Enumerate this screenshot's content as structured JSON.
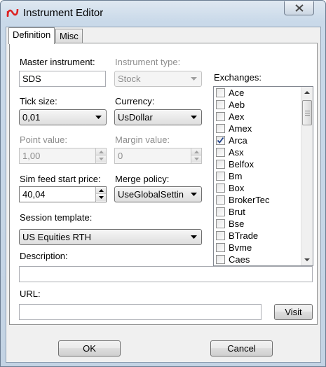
{
  "window": {
    "title": "Instrument Editor",
    "app_icon": "ninjatrader-logo-icon"
  },
  "tabs": [
    {
      "label": "Definition",
      "active": true
    },
    {
      "label": "Misc",
      "active": false
    }
  ],
  "form": {
    "master_instrument": {
      "label": "Master instrument:",
      "value": "SDS"
    },
    "instrument_type": {
      "label": "Instrument type:",
      "value": "Stock"
    },
    "tick_size": {
      "label": "Tick size:",
      "value": "0,01"
    },
    "currency": {
      "label": "Currency:",
      "value": "UsDollar"
    },
    "point_value": {
      "label": "Point value:",
      "value": "1,00"
    },
    "margin_value": {
      "label": "Margin value:",
      "value": "0"
    },
    "sim_feed_start_price": {
      "label": "Sim feed start price:",
      "value": "40,04"
    },
    "merge_policy": {
      "label": "Merge policy:",
      "value": "UseGlobalSettin"
    },
    "session_template": {
      "label": "Session template:",
      "value": "US Equities RTH"
    },
    "description": {
      "label": "Description:",
      "value": ""
    },
    "url": {
      "label": "URL:",
      "value": ""
    }
  },
  "exchanges": {
    "label": "Exchanges:",
    "items": [
      {
        "name": "Ace",
        "checked": false
      },
      {
        "name": "Aeb",
        "checked": false
      },
      {
        "name": "Aex",
        "checked": false
      },
      {
        "name": "Amex",
        "checked": false
      },
      {
        "name": "Arca",
        "checked": true
      },
      {
        "name": "Asx",
        "checked": false
      },
      {
        "name": "Belfox",
        "checked": false
      },
      {
        "name": "Bm",
        "checked": false
      },
      {
        "name": "Box",
        "checked": false
      },
      {
        "name": "BrokerTec",
        "checked": false
      },
      {
        "name": "Brut",
        "checked": false
      },
      {
        "name": "Bse",
        "checked": false
      },
      {
        "name": "BTrade",
        "checked": false
      },
      {
        "name": "Bvme",
        "checked": false
      },
      {
        "name": "Caes",
        "checked": false
      }
    ]
  },
  "buttons": {
    "visit": "Visit",
    "ok": "OK",
    "cancel": "Cancel"
  }
}
